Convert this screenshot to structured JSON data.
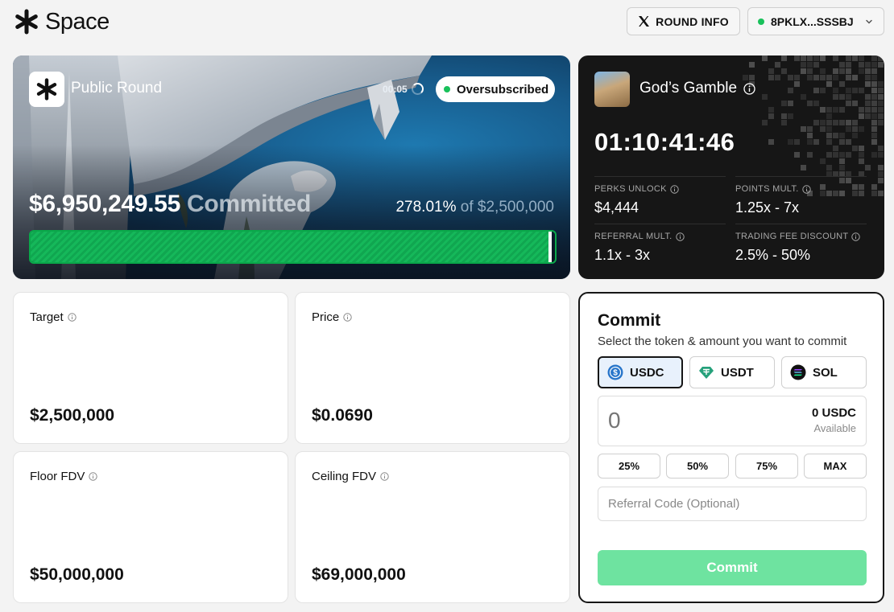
{
  "brand": {
    "name": "Space"
  },
  "header": {
    "round_info_label": "ROUND INFO",
    "wallet_label": "8PKLX...SSSBJ"
  },
  "hero": {
    "title": "Public Round",
    "timer": "00:05",
    "status_badge": "Oversubscribed",
    "committed_amount": "$6,950,249.55",
    "committed_word": "Committed",
    "percent": "278.01%",
    "of_text": "of $2,500,000",
    "progress_fraction": 1.0
  },
  "game": {
    "title": "God’s Gamble",
    "countdown": "01:10:41:46",
    "stats": [
      {
        "label": "PERKS UNLOCK",
        "value": "$4,444"
      },
      {
        "label": "POINTS MULT.",
        "value": "1.25x - 7x"
      },
      {
        "label": "REFERRAL MULT.",
        "value": "1.1x - 3x"
      },
      {
        "label": "TRADING FEE DISCOUNT",
        "value": "2.5% - 50%"
      }
    ]
  },
  "info_cards": [
    {
      "label": "Target",
      "value": "$2,500,000"
    },
    {
      "label": "Price",
      "value": "$0.0690"
    },
    {
      "label": "Floor FDV",
      "value": "$50,000,000"
    },
    {
      "label": "Ceiling FDV",
      "value": "$69,000,000"
    }
  ],
  "commit": {
    "title": "Commit",
    "subtitle": "Select the token & amount you want to commit",
    "tokens": [
      "USDC",
      "USDT",
      "SOL"
    ],
    "selected_token": "USDC",
    "amount_value": "0",
    "balance": "0 USDC",
    "available_label": "Available",
    "percent_buttons": [
      "25%",
      "50%",
      "75%",
      "MAX"
    ],
    "referral_placeholder": "Referral Code (Optional)",
    "submit_label": "Commit"
  },
  "colors": {
    "accent_green": "#15b85a",
    "commit_button": "#6ee3a0",
    "dark_card": "#161616"
  }
}
